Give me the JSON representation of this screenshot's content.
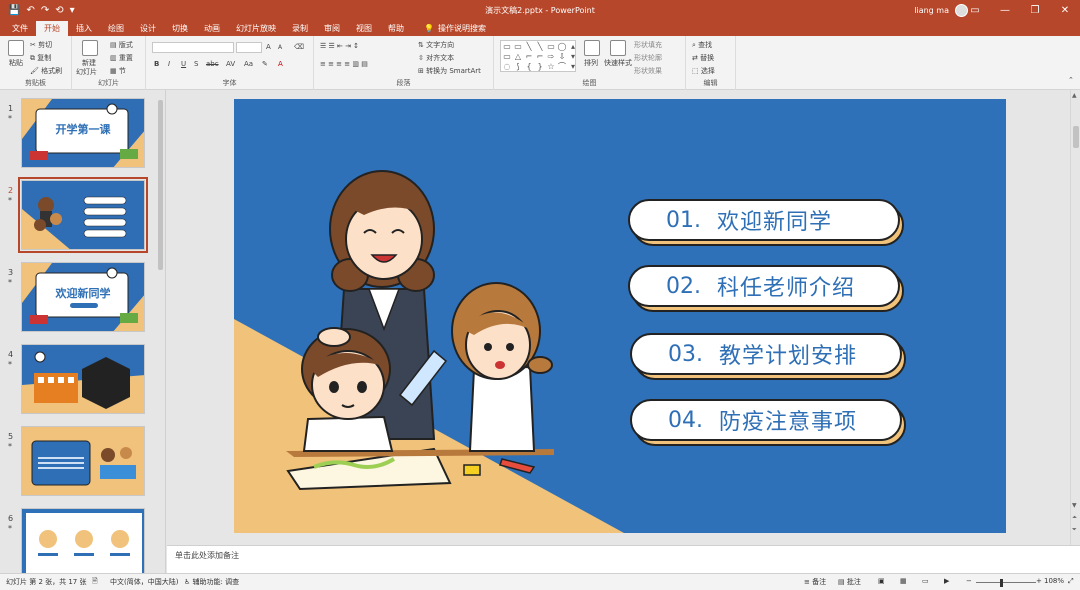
{
  "window": {
    "title": "演示文稿2.pptx  -  PowerPoint",
    "user": "liang ma",
    "qat": [
      "💾",
      "↶",
      "↷",
      "⟲",
      "▾"
    ],
    "controls": [
      "▭",
      "—",
      "❐",
      "✕"
    ]
  },
  "ribbon": {
    "tabs": [
      {
        "label": "文件",
        "active": false
      },
      {
        "label": "开始",
        "active": true
      },
      {
        "label": "插入",
        "active": false
      },
      {
        "label": "绘图",
        "active": false
      },
      {
        "label": "设计",
        "active": false
      },
      {
        "label": "切换",
        "active": false
      },
      {
        "label": "动画",
        "active": false
      },
      {
        "label": "幻灯片放映",
        "active": false
      },
      {
        "label": "录制",
        "active": false
      },
      {
        "label": "审阅",
        "active": false
      },
      {
        "label": "视图",
        "active": false
      },
      {
        "label": "帮助",
        "active": false
      }
    ],
    "tell_me": "操作说明搜索",
    "clipboard": {
      "label": "剪贴板",
      "paste": "粘贴",
      "cut": "剪切",
      "copy": "复制",
      "format_painter": "格式刷"
    },
    "slides": {
      "label": "幻灯片",
      "new_slide": "新建",
      "new_slide2": "幻灯片",
      "layout": "版式",
      "reset": "重置",
      "section": "节"
    },
    "font": {
      "label": "字体",
      "bold": "B",
      "italic": "I",
      "underline": "U",
      "shadow": "S",
      "strike": "abc",
      "spacing": "AV",
      "case": "Aa",
      "grow": "A",
      "shrink": "A"
    },
    "paragraph": {
      "label": "段落",
      "text_direction": "文字方向",
      "align_text": "对齐文本",
      "smartart": "转换为 SmartArt"
    },
    "drawing": {
      "label": "绘图",
      "arrange": "排列",
      "quick_styles": "快速样式",
      "fill": "形状填充",
      "outline": "形状轮廓",
      "effects": "形状效果"
    },
    "editing": {
      "label": "编辑",
      "find": "查找",
      "replace": "替换",
      "select": "选择"
    }
  },
  "thumbnails": [
    {
      "num": "1",
      "title": "开学第一课",
      "selected": false
    },
    {
      "num": "2",
      "title": "",
      "selected": true
    },
    {
      "num": "3",
      "title": "欢迎新同学",
      "selected": false
    },
    {
      "num": "4",
      "title": "",
      "selected": false
    },
    {
      "num": "5",
      "title": "",
      "selected": false
    },
    {
      "num": "6",
      "title": "",
      "selected": false
    }
  ],
  "slide": {
    "items": [
      {
        "num": "01.",
        "text": "欢迎新同学"
      },
      {
        "num": "02.",
        "text": "科任老师介绍"
      },
      {
        "num": "03.",
        "text": "教学计划安排"
      },
      {
        "num": "04.",
        "text": "防疫注意事项"
      }
    ],
    "colors": {
      "background": "#2e71b8",
      "accent": "#f1c27a",
      "text": "#2e6fb6"
    }
  },
  "notes": {
    "placeholder": "单击此处添加备注"
  },
  "status": {
    "slide_info": "幻灯片 第 2 张，共 17 张",
    "language": "中文(简体，中国大陆)",
    "accessibility": "辅助功能: 调查",
    "notes_btn": "备注",
    "comments_btn": "批注",
    "zoom": "108%"
  }
}
